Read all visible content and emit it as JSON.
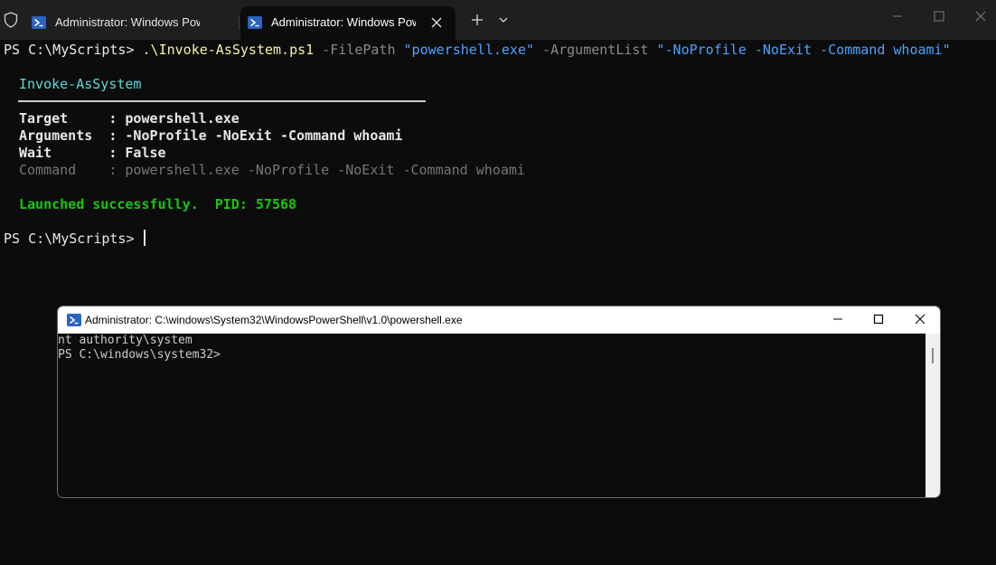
{
  "tabs": [
    {
      "title": "Administrator: Windows PowerShell",
      "icon": "powershell-icon",
      "active": false
    },
    {
      "title": "Administrator: Windows PowerShell",
      "icon": "powershell-icon",
      "active": true
    }
  ],
  "terminal": {
    "command": {
      "prompt": "PS C:\\MyScripts> ",
      "script": ".\\Invoke-AsSystem.ps1",
      "param1": " -FilePath ",
      "value1": "\"powershell.exe\"",
      "param2": " -ArgumentList ",
      "value2": "\"-NoProfile -NoExit -Command whoami\""
    },
    "header": "Invoke-AsSystem",
    "rows": [
      {
        "key": "Target     : ",
        "value": "powershell.exe"
      },
      {
        "key": "Arguments  : ",
        "value": "-NoProfile -NoExit -Command whoami"
      },
      {
        "key": "Wait       : ",
        "value": "False"
      },
      {
        "key": "Command    : ",
        "value": "powershell.exe -NoProfile -NoExit -Command whoami"
      }
    ],
    "status": "Launched successfully.  PID: 57568",
    "prompt2": "PS C:\\MyScripts> "
  },
  "child_window": {
    "title": "Administrator: C:\\windows\\System32\\WindowsPowerShell\\v1.0\\powershell.exe",
    "lines": [
      "nt authority\\system",
      "PS C:\\windows\\system32>"
    ]
  },
  "colors": {
    "background": "#0c0c0c",
    "tabbar": "#1f1f1f",
    "script_yellow": "#f9f1a5",
    "string_blue": "#4ea1ff",
    "header_cyan": "#61d6d6",
    "success_green": "#16c60c"
  }
}
